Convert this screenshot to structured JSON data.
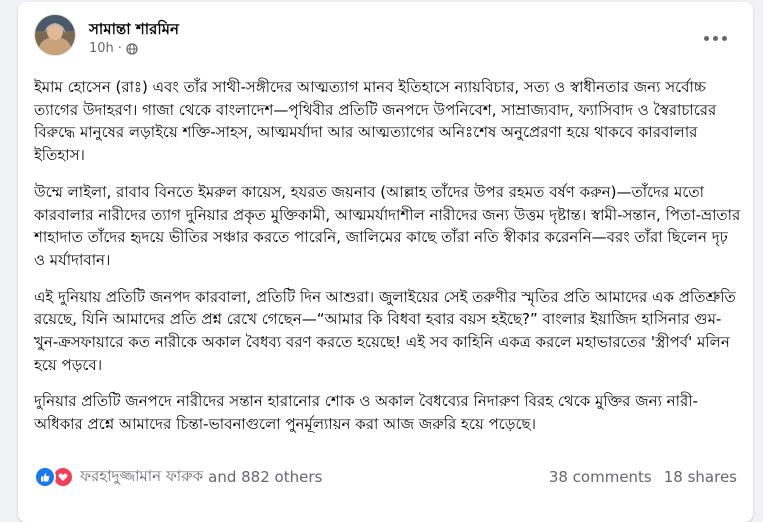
{
  "post": {
    "author": "সামান্তা শারমিন",
    "time": "10h",
    "separator": "·",
    "paragraphs": [
      "ইমাম হোসেন (রাঃ) এবং তাঁর সাথী-সঙ্গীদের আত্মত্যাগ মানব ইতিহাসে ন্যায়বিচার, সত্য ও স্বাধীনতার জন্য সর্বোচ্চ ত্যাগের উদাহরণ। গাজা থেকে বাংলাদেশ—পৃথিবীর প্রতিটি জনপদে উপনিবেশ, সাম্রাজ্যবাদ, ফ্যাসিবাদ ও স্বৈরাচারের বিরুদ্ধে মানুষের লড়াইয়ে শক্তি-সাহস, আত্মমর্যাদা আর আত্মত্যাগের অনিঃশেষ অনুপ্রেরণা হয়ে থাকবে কারবালার ইতিহাস।",
      "উম্মে লাইলা, রাবাব বিনতে ইমরুল কায়েস, হযরত জয়নাব (আল্লাহ তাঁদের উপর রহমত বর্ষণ করুন)—তাঁদের মতো কারবালার নারীদের ত্যাগ দুনিয়ার প্রকৃত মুক্তিকামী, আত্মমর্যাদাশীল নারীদের জন্য উত্তম দৃষ্টান্ত। স্বামী-সন্তান, পিতা-ভ্রাতার শাহাদাত তাঁদের হৃদয়ে ভীতির সঞ্চার করতে পারেনি, জালিমের কাছে তাঁরা নতি স্বীকার করেননি—বরং তাঁরা ছিলেন দৃঢ় ও মর্যাদাবান।",
      "এই দুনিয়ায় প্রতিটি জনপদ কারবালা, প্রতিটি দিন আশুরা। জুলাইয়ের সেই তরুণীর স্মৃতির প্রতি আমাদের এক প্রতিশ্রুতি রয়েছে, যিনি আমাদের প্রতি প্রশ্ন রেখে গেছেন—“আমার কি বিধবা হবার বয়স হইছে?” বাংলার ইয়াজিদ হাসিনার গুম-খুন-ক্রসফায়ারে কত নারীকে অকাল বৈধব্য বরণ করতে হয়েছে! এই সব কাহিনি একত্র করলে মহাভারতের 'স্ত্রীপর্ব' মলিন হয়ে পড়বে।",
      "দুনিয়ার প্রতিটি জনপদে নারীদের সন্তান হারানোর শোক ও অকাল বৈধব্যের নিদারুণ বিরহ থেকে মুক্তির জন্য নারী-অধিকার প্রশ্নে আমাদের চিন্তা-ভাবনাগুলো পুনর্মূল্যায়ন করা আজ জরুরি হয়ে পড়েছে।"
    ],
    "reactions": {
      "icons": [
        "like-icon",
        "love-icon"
      ],
      "reactor_name": "ফরহাদুজ্জামান ফারুক",
      "others": "and 882 others"
    },
    "comments": "38 comments",
    "shares": "18 shares",
    "colors": {
      "like": "#1877f2",
      "love": "#f33e58",
      "secondary_text": "#65676b"
    }
  }
}
